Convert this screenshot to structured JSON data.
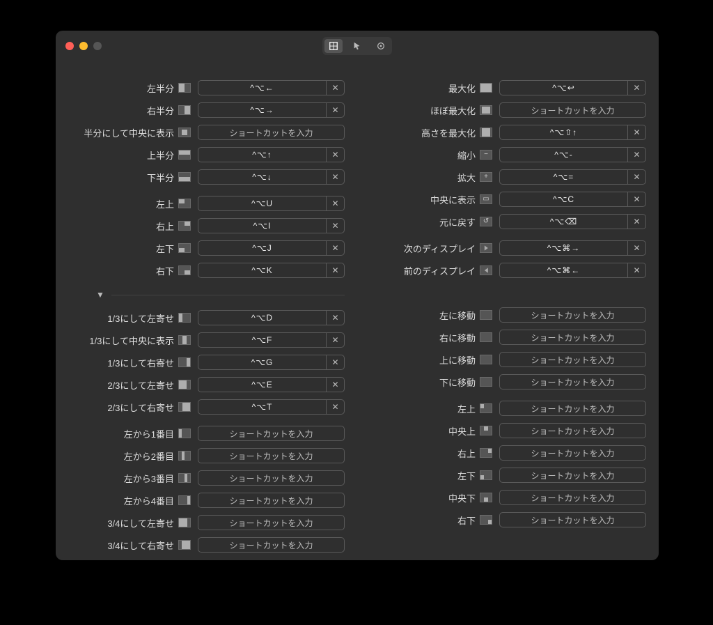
{
  "placeholder": "ショートカットを入力",
  "left": {
    "g1": [
      {
        "label": "左半分",
        "glyph": "g-left",
        "shortcut": "^⌥←"
      },
      {
        "label": "右半分",
        "glyph": "g-right",
        "shortcut": "^⌥→"
      },
      {
        "label": "半分にして中央に表示",
        "glyph": "g-center",
        "shortcut": null
      },
      {
        "label": "上半分",
        "glyph": "g-top",
        "shortcut": "^⌥↑"
      },
      {
        "label": "下半分",
        "glyph": "g-bottom",
        "shortcut": "^⌥↓"
      }
    ],
    "g2": [
      {
        "label": "左上",
        "glyph": "g-tl",
        "shortcut": "^⌥U"
      },
      {
        "label": "右上",
        "glyph": "g-tr",
        "shortcut": "^⌥I"
      },
      {
        "label": "左下",
        "glyph": "g-bl",
        "shortcut": "^⌥J"
      },
      {
        "label": "右下",
        "glyph": "g-br",
        "shortcut": "^⌥K"
      }
    ],
    "g3": [
      {
        "label": "1/3にして左寄せ",
        "glyph": "g-third-l",
        "shortcut": "^⌥D"
      },
      {
        "label": "1/3にして中央に表示",
        "glyph": "g-third-c",
        "shortcut": "^⌥F"
      },
      {
        "label": "1/3にして右寄せ",
        "glyph": "g-third-r",
        "shortcut": "^⌥G"
      },
      {
        "label": "2/3にして左寄せ",
        "glyph": "g-twothird-l",
        "shortcut": "^⌥E"
      },
      {
        "label": "2/3にして右寄せ",
        "glyph": "g-twothird-r",
        "shortcut": "^⌥T"
      }
    ],
    "g4": [
      {
        "label": "左から1番目",
        "glyph": "g-q1",
        "shortcut": null
      },
      {
        "label": "左から2番目",
        "glyph": "g-q2",
        "shortcut": null
      },
      {
        "label": "左から3番目",
        "glyph": "g-q3",
        "shortcut": null
      },
      {
        "label": "左から4番目",
        "glyph": "g-q4",
        "shortcut": null
      },
      {
        "label": "3/4にして左寄せ",
        "glyph": "g-34l",
        "shortcut": null
      },
      {
        "label": "3/4にして右寄せ",
        "glyph": "g-34r",
        "shortcut": null
      }
    ]
  },
  "right": {
    "g1": [
      {
        "label": "最大化",
        "glyph": "g-full",
        "shortcut": "^⌥↩"
      },
      {
        "label": "ほぼ最大化",
        "glyph": "g-almost",
        "shortcut": null
      },
      {
        "label": "高さを最大化",
        "glyph": "g-hfull",
        "shortcut": "^⌥⇧↑"
      },
      {
        "label": "縮小",
        "glyph": "g-minus",
        "sym": "−",
        "shortcut": "^⌥-"
      },
      {
        "label": "拡大",
        "glyph": "g-plus",
        "sym": "+",
        "shortcut": "^⌥="
      },
      {
        "label": "中央に表示",
        "glyph": "g-centerbox",
        "sym": "▭",
        "shortcut": "^⌥C"
      },
      {
        "label": "元に戻す",
        "glyph": "g-undo",
        "sym": "↺",
        "shortcut": "^⌥⌫"
      }
    ],
    "g2": [
      {
        "label": "次のディスプレイ",
        "glyph": "g-next",
        "chev": "r",
        "shortcut": "^⌥⌘→"
      },
      {
        "label": "前のディスプレイ",
        "glyph": "g-prev",
        "chev": "l",
        "shortcut": "^⌥⌘←"
      }
    ],
    "g3": [
      {
        "label": "左に移動",
        "glyph": "g-movel",
        "shortcut": null
      },
      {
        "label": "右に移動",
        "glyph": "g-mover",
        "shortcut": null
      },
      {
        "label": "上に移動",
        "glyph": "g-moveu",
        "shortcut": null
      },
      {
        "label": "下に移動",
        "glyph": "g-moved",
        "shortcut": null
      }
    ],
    "g4": [
      {
        "label": "左上",
        "glyph": "g-sixth-tl",
        "shortcut": null
      },
      {
        "label": "中央上",
        "glyph": "g-sixth-tc",
        "shortcut": null
      },
      {
        "label": "右上",
        "glyph": "g-sixth-tr",
        "shortcut": null
      },
      {
        "label": "左下",
        "glyph": "g-sixth-bl",
        "shortcut": null
      },
      {
        "label": "中央下",
        "glyph": "g-sixth-bc",
        "shortcut": null
      },
      {
        "label": "右下",
        "glyph": "g-sixth-br",
        "shortcut": null
      }
    ]
  }
}
